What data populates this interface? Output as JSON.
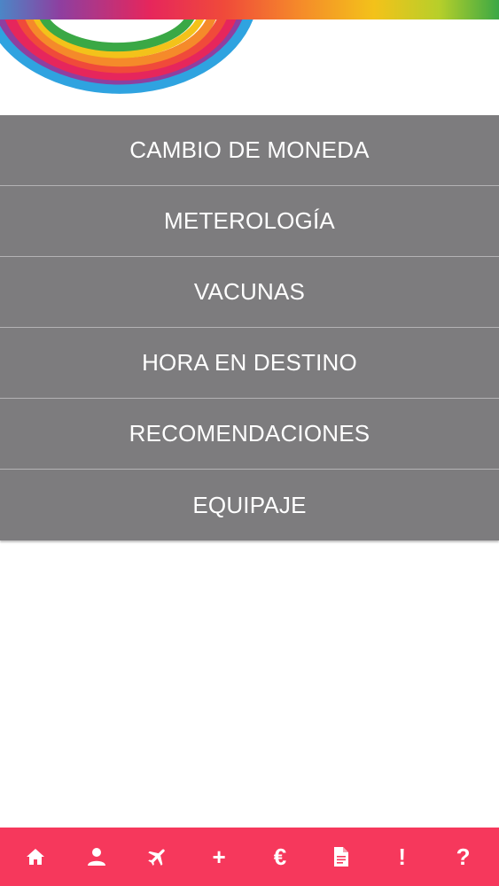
{
  "theme": {
    "menu_background": "#7d7c7e",
    "menu_divider": "#b4b3b5",
    "menu_text": "#ffffff",
    "bottom_nav_background": "#f6385c"
  },
  "menu": {
    "items": [
      {
        "label": "CAMBIO DE MONEDA"
      },
      {
        "label": "METEROLOGÍA"
      },
      {
        "label": "VACUNAS"
      },
      {
        "label": "HORA EN DESTINO"
      },
      {
        "label": "RECOMENDACIONES"
      },
      {
        "label": "EQUIPAJE"
      }
    ]
  },
  "bottom_nav": {
    "items": [
      {
        "icon": "home-icon"
      },
      {
        "icon": "user-icon"
      },
      {
        "icon": "airplane-icon"
      },
      {
        "icon": "plus-icon",
        "glyph": "+"
      },
      {
        "icon": "euro-icon",
        "glyph": "€"
      },
      {
        "icon": "document-icon"
      },
      {
        "icon": "exclamation-icon",
        "glyph": "!"
      },
      {
        "icon": "question-icon",
        "glyph": "?"
      }
    ]
  }
}
